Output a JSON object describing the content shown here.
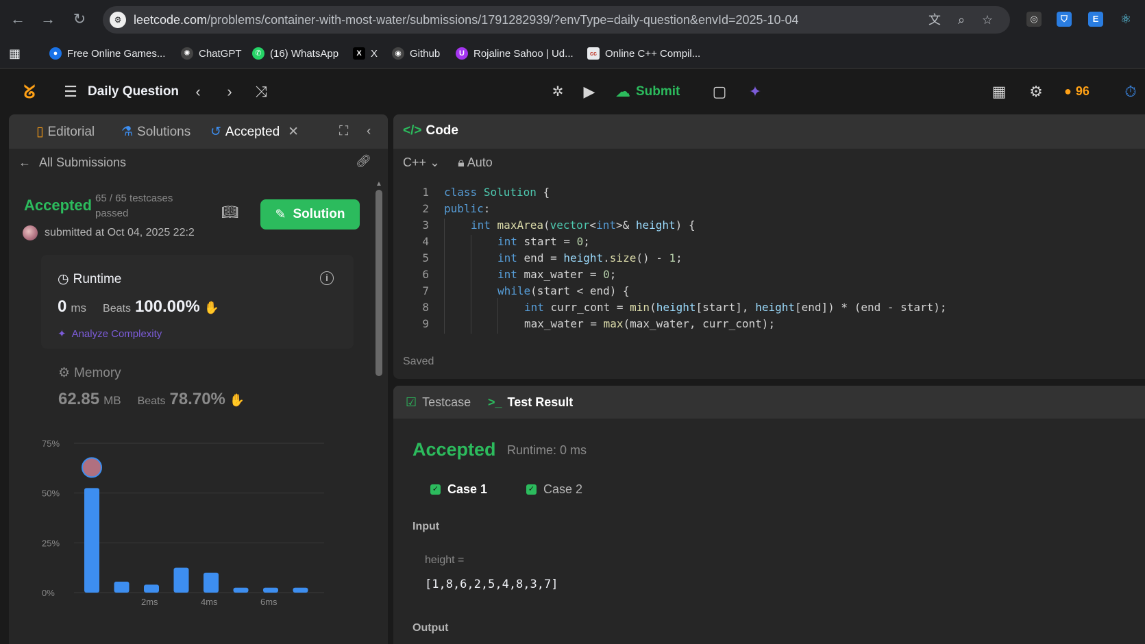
{
  "browser": {
    "url_host": "leetcode.com",
    "url_path": "/problems/container-with-most-water/submissions/1791282939/?envType=daily-question&envId=2025-10-04",
    "bookmarks": [
      {
        "label": "Free Online Games...",
        "icon": "globe-icon",
        "color": "#1a73e8"
      },
      {
        "label": "ChatGPT",
        "icon": "chatgpt-icon",
        "color": "#3c3c3c"
      },
      {
        "label": "(16) WhatsApp",
        "icon": "whatsapp-icon",
        "color": "#25d366"
      },
      {
        "label": "X",
        "icon": "x-icon",
        "color": "#000000"
      },
      {
        "label": "Github",
        "icon": "github-icon",
        "color": "#3c3c3c"
      },
      {
        "label": "Rojaline Sahoo | Ud...",
        "icon": "udemy-icon",
        "color": "#a435f0"
      },
      {
        "label": "Online C++ Compil...",
        "icon": "cc-icon",
        "color": "#e8eaed"
      }
    ]
  },
  "header": {
    "title": "Daily Question",
    "submit_label": "Submit",
    "streak": "96"
  },
  "left": {
    "tabs": {
      "editorial": "Editorial",
      "solutions": "Solutions",
      "accepted": "Accepted"
    },
    "all_submissions": "All Submissions",
    "status": "Accepted",
    "testcases": "65 / 65 testcases passed",
    "submitted_at": "submitted at Oct 04, 2025 22:2",
    "solution_label": "Solution",
    "runtime": {
      "label": "Runtime",
      "value": "0",
      "unit": "ms",
      "beats_label": "Beats",
      "beats": "100.00%",
      "analyze": "Analyze Complexity"
    },
    "memory": {
      "label": "Memory",
      "value": "62.85",
      "unit": "MB",
      "beats_label": "Beats",
      "beats": "78.70%"
    }
  },
  "chart_data": {
    "type": "bar",
    "yticks": [
      "75%",
      "50%",
      "25%",
      "0%"
    ],
    "ylim": [
      0,
      75
    ],
    "xticks": [
      "2ms",
      "4ms",
      "6ms"
    ],
    "values": [
      52.5,
      5.5,
      4,
      12.5,
      10,
      2.5,
      2.5,
      2.5
    ],
    "bar_color": "#3d8ef0",
    "highlight_index": 0
  },
  "code_panel": {
    "title": "Code",
    "language": "C++",
    "mode": "Auto",
    "status": "Saved",
    "lines": [
      {
        "n": "1",
        "indent": 0
      },
      {
        "n": "2",
        "indent": 0
      },
      {
        "n": "3",
        "indent": 1
      },
      {
        "n": "4",
        "indent": 2
      },
      {
        "n": "5",
        "indent": 2
      },
      {
        "n": "6",
        "indent": 2
      },
      {
        "n": "7",
        "indent": 2
      },
      {
        "n": "8",
        "indent": 3
      },
      {
        "n": "9",
        "indent": 3
      }
    ],
    "source": [
      "class Solution {",
      "public:",
      "int maxArea(vector<int>& height) {",
      "int start = 0;",
      "int end = height.size() - 1;",
      "int max_water = 0;",
      "while(start < end) {",
      "int curr_cont = min(height[start], height[end]) * (end - start);",
      "max_water = max(max_water, curr_cont);"
    ]
  },
  "result": {
    "tab_testcase": "Testcase",
    "tab_result": "Test Result",
    "status": "Accepted",
    "runtime": "Runtime: 0 ms",
    "cases": [
      "Case 1",
      "Case 2"
    ],
    "input_label": "Input",
    "param_name": "height =",
    "param_value": "[1,8,6,2,5,4,8,3,7]",
    "output_label": "Output"
  }
}
